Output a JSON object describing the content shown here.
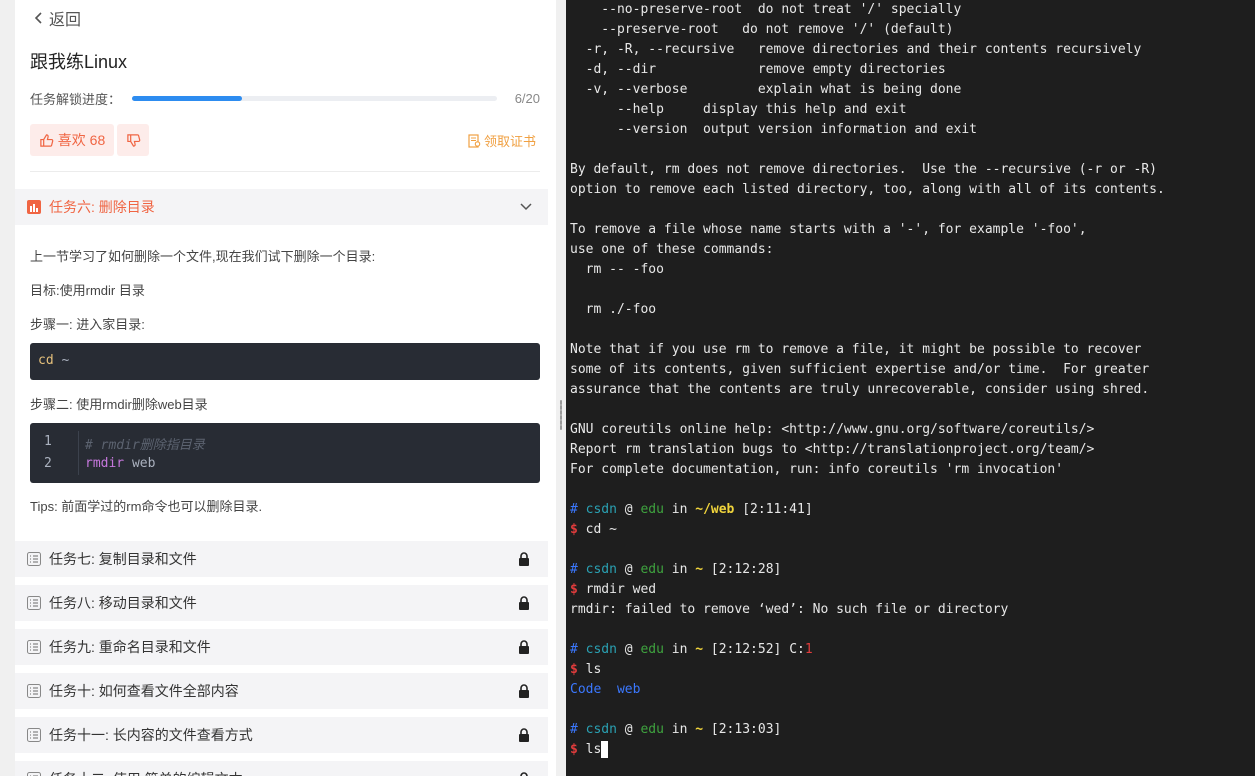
{
  "left": {
    "back_label": "返回",
    "course_title": "跟我练Linux",
    "progress": {
      "label": "任务解锁进度：",
      "count_text": "6/20",
      "fraction": 0.3
    },
    "like_label": "喜欢 68",
    "certificate_label": "领取证书",
    "active_task": {
      "title": "任务六: 删除目录",
      "intro": "上一节学习了如何删除一个文件,现在我们试下删除一个目录:",
      "goal": "目标:使用rmdir 目录",
      "step1": "步骤一: 进入家目录:",
      "code1": {
        "cmd": "cd",
        "arg": "~"
      },
      "step2": "步骤二: 使用rmdir删除web目录",
      "code2": {
        "lines": [
          {
            "num": "1",
            "comment": "# rmdir删除指目录"
          },
          {
            "num": "2",
            "kw": "rmdir",
            "arg": "web"
          }
        ]
      },
      "tips": "Tips: 前面学过的rm命令也可以删除目录."
    },
    "locked_tasks": [
      "任务七: 复制目录和文件",
      "任务八: 移动目录和文件",
      "任务九: 重命名目录和文件",
      "任务十: 如何查看文件全部内容",
      "任务十一: 长内容的文件查看方式",
      "任务十二: 使用 简单的编辑文本"
    ]
  },
  "terminal": {
    "help_lines": [
      "    --no-preserve-root  do not treat '/' specially",
      "    --preserve-root   do not remove '/' (default)",
      "  -r, -R, --recursive   remove directories and their contents recursively",
      "  -d, --dir             remove empty directories",
      "  -v, --verbose         explain what is being done",
      "      --help     display this help and exit",
      "      --version  output version information and exit",
      "",
      "By default, rm does not remove directories.  Use the --recursive (-r or -R)",
      "option to remove each listed directory, too, along with all of its contents.",
      "",
      "To remove a file whose name starts with a '-', for example '-foo',",
      "use one of these commands:",
      "  rm -- -foo",
      "",
      "  rm ./-foo",
      "",
      "Note that if you use rm to remove a file, it might be possible to recover",
      "some of its contents, given sufficient expertise and/or time.  For greater",
      "assurance that the contents are truly unrecoverable, consider using shred.",
      "",
      "GNU coreutils online help: <http://www.gnu.org/software/coreutils/>",
      "Report rm translation bugs to <http://translationproject.org/team/>",
      "For complete documentation, run: info coreutils 'rm invocation'"
    ],
    "prompts": [
      {
        "user": "csdn",
        "host": "edu",
        "dir": "~/web",
        "time": "[2:11:41]",
        "cmd": "cd ~",
        "output": ""
      },
      {
        "user": "csdn",
        "host": "edu",
        "dir": "~",
        "time": "[2:12:28]",
        "cmd": "rmdir wed",
        "output": "rmdir: failed to remove ‘wed’: No such file or directory"
      },
      {
        "user": "csdn",
        "host": "edu",
        "dir": "~",
        "time": "[2:12:52]",
        "exit_label": "C:",
        "exit_code": "1",
        "cmd": "ls",
        "output_dirs": [
          "Code",
          "web"
        ]
      },
      {
        "user": "csdn",
        "host": "edu",
        "dir": "~",
        "time": "[2:13:03]",
        "cmd": "ls",
        "output": ""
      }
    ],
    "colors": {
      "background": "#1e1e1e",
      "user": "#2aa1b3",
      "host": "#3fa33f",
      "dir": "#f0d43c",
      "dollar": "#e03c3c"
    }
  }
}
